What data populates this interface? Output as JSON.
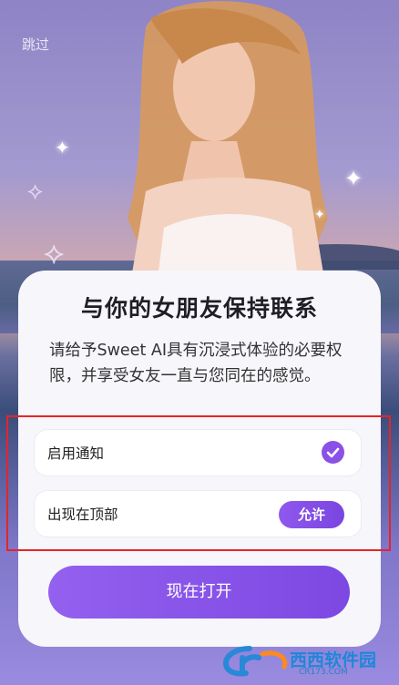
{
  "skip_label": "跳过",
  "card": {
    "title": "与你的女朋友保持联系",
    "description": "请给予Sweet AI具有沉浸式体验的必要权限，并享受女友一直与您同在的感觉。",
    "rows": [
      {
        "label": "启用通知",
        "state": "checked"
      },
      {
        "label": "出现在顶部",
        "action_label": "允许"
      }
    ],
    "primary_button": "现在打开"
  },
  "watermark": {
    "text": "西西软件园",
    "url": "CR173.COM"
  },
  "colors": {
    "accent": "#8a51e6",
    "highlight_border": "#e6242a",
    "card_bg": "#f7f6fb"
  }
}
